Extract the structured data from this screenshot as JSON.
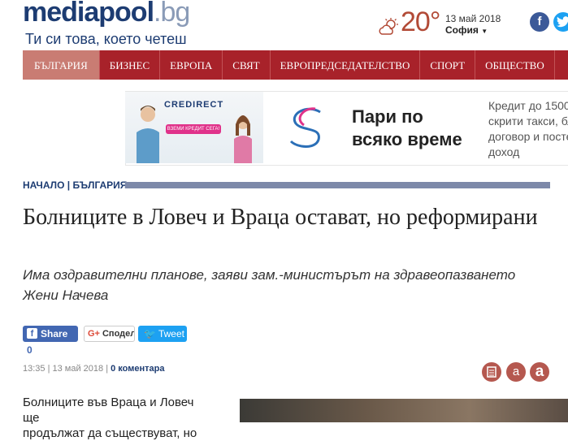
{
  "header": {
    "logo_main": "mediapool",
    "logo_dot": ".bg",
    "tagline": "Ти си това, което четеш",
    "temperature": "20°",
    "date": "13 май 2018",
    "city": "София",
    "social": {
      "facebook": "f",
      "twitter": "t"
    }
  },
  "nav": {
    "items": [
      "БЪЛГАРИЯ",
      "БИЗНЕС",
      "ЕВРОПА",
      "СВЯТ",
      "ЕВРОПРЕДСЕДАТЕЛСТВО",
      "СПОРТ",
      "ОБЩЕСТВО"
    ]
  },
  "ad": {
    "brand": "CREDIRECT",
    "cta": "ВЗЕМИ КРЕДИТ СЕГА!",
    "heading_line1": "Пари по",
    "heading_line2": "всяко време",
    "text_line1": "Кредит до 1500",
    "text_line2": "скрити такси, бл",
    "text_line3": "договор и посте",
    "text_line4": "доход"
  },
  "article": {
    "breadcrumb": "НАЧАЛО | БЪЛГАРИЯ",
    "title": "Болниците в Ловеч и Враца остават, но реформирани",
    "subtitle": "Има оздравителни планове, заяви зам.-министърът на здравеопазването Жени Начева",
    "share": {
      "facebook_label": "Share",
      "facebook_count": "0",
      "google_label": "Споделете",
      "twitter_label": "Tweet"
    },
    "meta_time": "13:35 | 13 май 2018 |",
    "meta_comments": "0 коментара",
    "body_line1": "Болниците във Враца и Ловеч ще",
    "body_line2": "продължат да съществуват, но"
  },
  "colors": {
    "brand_blue": "#1d3c72",
    "nav_red": "#a8222a",
    "accent": "#b5584f"
  }
}
